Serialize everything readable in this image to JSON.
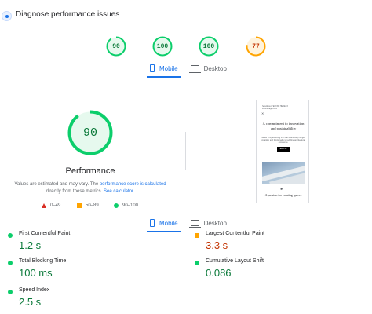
{
  "header": {
    "title": "Diagnose performance issues",
    "icon": "diagnose-icon"
  },
  "colors": {
    "good": "#0cce6b",
    "good_text": "#0c7a3b",
    "average": "#ffa400",
    "average_text": "#c33300",
    "poor": "#d93025",
    "accent": "#1a73e8"
  },
  "category_scores": [
    {
      "score": 90,
      "rating": "good"
    },
    {
      "score": 100,
      "rating": "good"
    },
    {
      "score": 100,
      "rating": "good"
    },
    {
      "score": 77,
      "rating": "average"
    }
  ],
  "device_tabs": {
    "mobile": "Mobile",
    "desktop": "Desktop",
    "active": "mobile"
  },
  "performance": {
    "score": 90,
    "title": "Performance",
    "note_prefix": "Values are estimated and may vary. The ",
    "note_link": "performance score is calculated",
    "note_mid": "directly from these metrics. ",
    "note_link2": "See calculator."
  },
  "legend": {
    "poor": "0–49",
    "average": "50–89",
    "good": "90–100"
  },
  "preview": {
    "header_text": "hereAbout TEXXXP HEREXX sitemanager.com",
    "close_mark": "✕",
    "headline": "A commitment to innovation and sustainability",
    "body": "Studio is a pioneering firm that seamlessly merges creativity and functionality to redefine architectural excellence.",
    "button": "About us",
    "star": "✱",
    "caption": "A passion for creating spaces"
  },
  "metrics": [
    {
      "label": "First Contentful Paint",
      "value": "1.2 s",
      "rating": "good"
    },
    {
      "label": "Largest Contentful Paint",
      "value": "3.3 s",
      "rating": "average"
    },
    {
      "label": "Total Blocking Time",
      "value": "100 ms",
      "rating": "good"
    },
    {
      "label": "Cumulative Layout Shift",
      "value": "0.086",
      "rating": "good"
    },
    {
      "label": "Speed Index",
      "value": "2.5 s",
      "rating": "good"
    }
  ]
}
